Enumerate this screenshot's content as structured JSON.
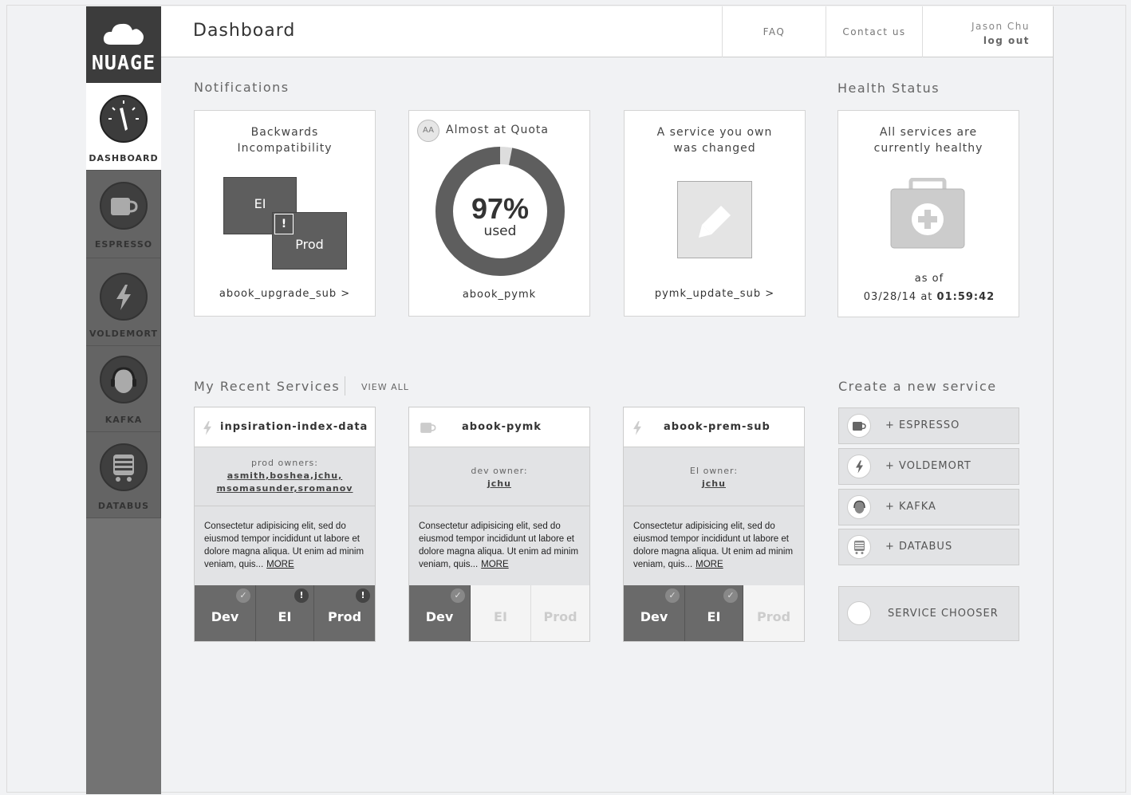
{
  "brand": {
    "name": "NUAGE"
  },
  "sidebar": {
    "items": [
      {
        "label": "DASHBOARD",
        "icon": "gauge-icon"
      },
      {
        "label": "ESPRESSO",
        "icon": "coffee-cup-icon"
      },
      {
        "label": "VOLDEMORT",
        "icon": "lightning-icon"
      },
      {
        "label": "KAFKA",
        "icon": "head-icon"
      },
      {
        "label": "DATABUS",
        "icon": "bus-icon"
      }
    ]
  },
  "header": {
    "title": "Dashboard",
    "faq": "FAQ",
    "contact": "Contact us",
    "user_name": "Jason Chu",
    "logout": "log out"
  },
  "notifications": {
    "title": "Notifications",
    "cards": [
      {
        "title": "Backwards Incompatibility",
        "box_a": "EI",
        "box_b": "Prod",
        "alert": "!",
        "footer": "abook_upgrade_sub",
        "arrow": ">"
      },
      {
        "badge": "AA",
        "title": "Almost at Quota",
        "percent": "97%",
        "percent_value": 0.97,
        "used": "used",
        "footer": "abook_pymk"
      },
      {
        "title": "A service you own was changed",
        "footer": "pymk_update_sub",
        "arrow": ">"
      }
    ]
  },
  "health": {
    "title": "Health Status",
    "message": "All services are currently healthy",
    "as_of": "as of",
    "date": "03/28/14",
    "at": "at",
    "time": "01:59:42"
  },
  "recent": {
    "title": "My Recent Services",
    "view_all": "VIEW ALL",
    "services": [
      {
        "name": "inpsiration-index-data",
        "icon": "lightning-icon",
        "owner_label": "prod owners:",
        "owners": "asmith,boshea,jchu,",
        "owners2": "msomasunder,sromanov",
        "desc": "Consectetur adipisicing elit, sed do eiusmod tempor incididunt ut labore et dolore magna aliqua. Ut enim ad minim veniam, quis...",
        "more": "MORE",
        "envs": [
          {
            "label": "Dev",
            "active": true,
            "badge": "✓",
            "ok": true
          },
          {
            "label": "EI",
            "active": true,
            "badge": "!",
            "ok": false
          },
          {
            "label": "Prod",
            "active": true,
            "badge": "!",
            "ok": false
          }
        ]
      },
      {
        "name": "abook-pymk",
        "icon": "coffee-cup-icon",
        "owner_label": "dev owner:",
        "owners": "jchu",
        "owners2": "",
        "desc": "Consectetur adipisicing elit, sed do eiusmod tempor incididunt ut labore et dolore magna aliqua. Ut enim ad minim veniam, quis...",
        "more": "MORE",
        "envs": [
          {
            "label": "Dev",
            "active": true,
            "badge": "✓",
            "ok": true
          },
          {
            "label": "EI",
            "active": false,
            "badge": "",
            "ok": true
          },
          {
            "label": "Prod",
            "active": false,
            "badge": "",
            "ok": true
          }
        ]
      },
      {
        "name": "abook-prem-sub",
        "icon": "lightning-icon",
        "owner_label": "EI owner:",
        "owners": "jchu",
        "owners2": "",
        "desc": "Consectetur adipisicing elit, sed do eiusmod tempor incididunt ut labore et dolore magna aliqua. Ut enim ad minim veniam, quis...",
        "more": "MORE",
        "envs": [
          {
            "label": "Dev",
            "active": true,
            "badge": "✓",
            "ok": true
          },
          {
            "label": "EI",
            "active": true,
            "badge": "✓",
            "ok": true
          },
          {
            "label": "Prod",
            "active": false,
            "badge": "",
            "ok": true
          }
        ]
      }
    ]
  },
  "create": {
    "title": "Create a new service",
    "buttons": [
      {
        "label": "+  ESPRESSO",
        "icon": "coffee-cup-icon"
      },
      {
        "label": "+  VOLDEMORT",
        "icon": "lightning-icon"
      },
      {
        "label": "+  KAFKA",
        "icon": "head-icon"
      },
      {
        "label": "+  DATABUS",
        "icon": "bus-icon"
      }
    ],
    "chooser": "SERVICE CHOOSER"
  }
}
